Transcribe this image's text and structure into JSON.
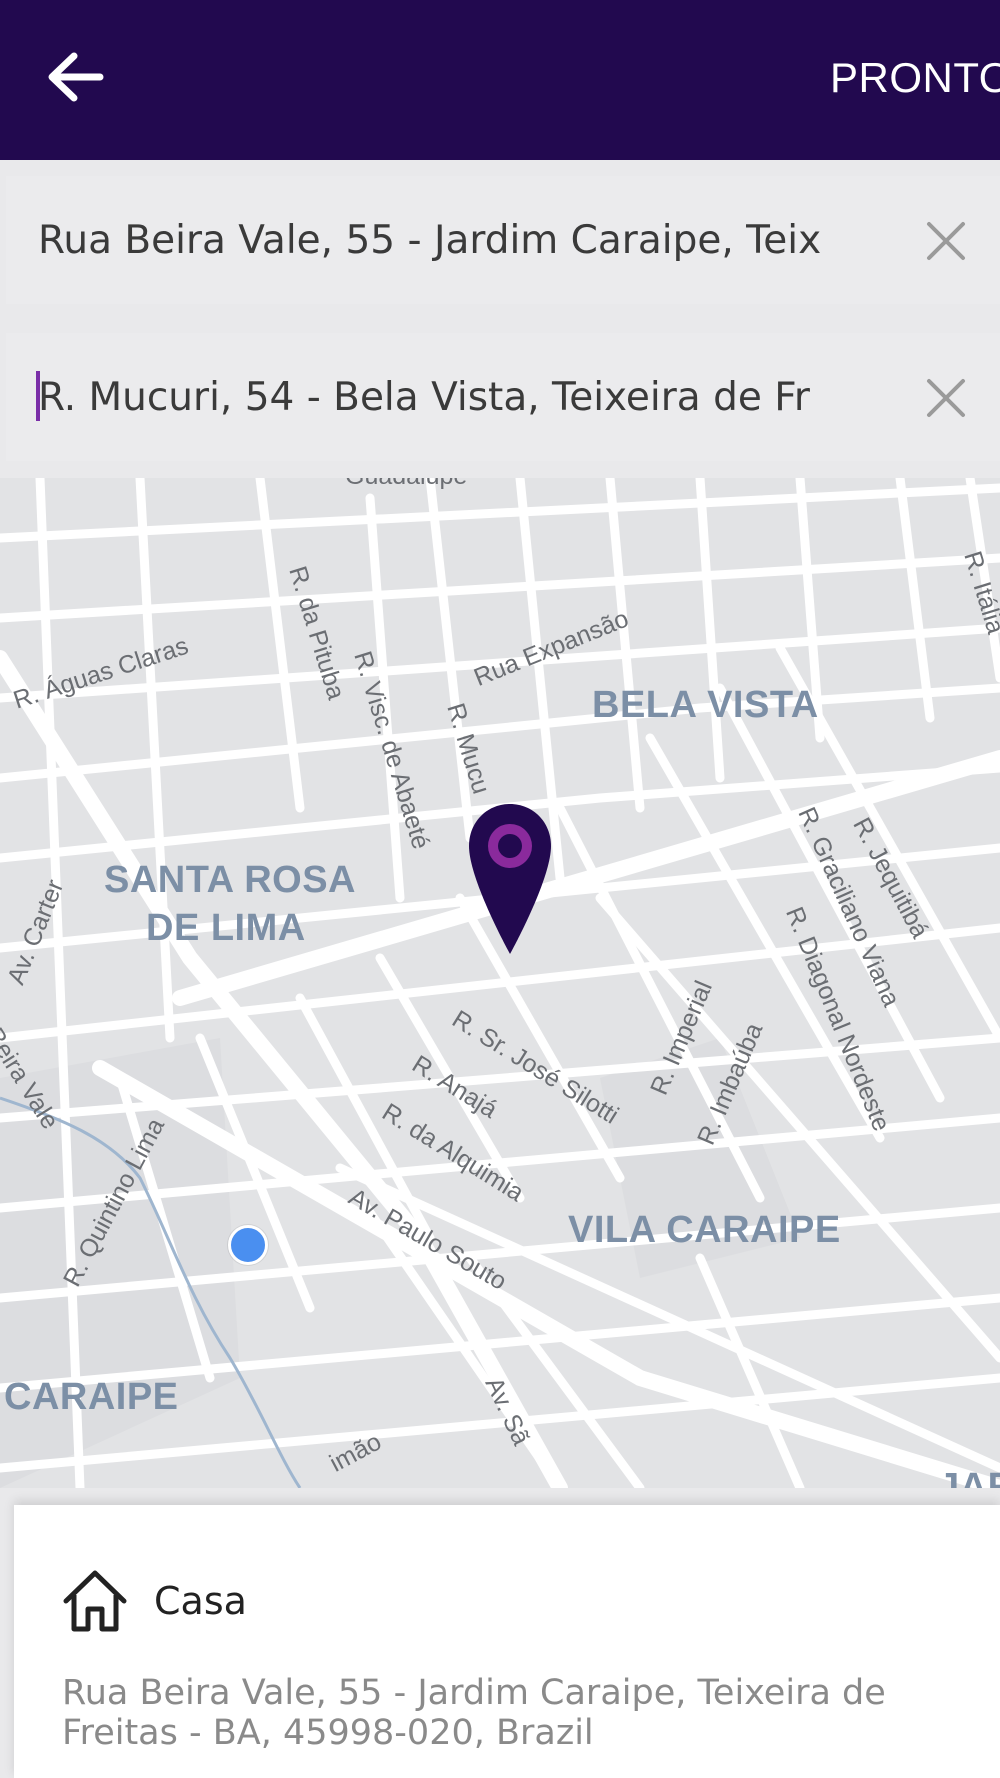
{
  "header": {
    "back_icon": "arrow-left-icon",
    "done_label": "PRONTO",
    "background": "#22094f"
  },
  "route": {
    "pickup": {
      "value": "Rua Beira Vale, 55 - Jardim Caraipe, Teix",
      "clear_icon": "close-icon"
    },
    "destination": {
      "value": "R. Mucuri, 54 - Bela Vista, Teixeira de Fr",
      "clear_icon": "close-icon"
    }
  },
  "map": {
    "neighborhoods": {
      "bela_vista": "BELA VISTA",
      "santa_rosa_1": "SANTA ROSA",
      "santa_rosa_2": "DE LIMA",
      "vila_caraipe": "VILA CARAIPE",
      "caraipe": "CARAIPE",
      "jar": "JAR"
    },
    "streets": {
      "aguas_claras": "R. Águas Claras",
      "pituba": "R. da Pituba",
      "visc_abaete": "R. Visc. de Abaeté",
      "mucuri": "R. Mucu",
      "expansao": "Rua Expansão",
      "italia": "R. Itália",
      "graciliano": "R. Graciliano Viana",
      "jequitiba": "R. Jequitibá",
      "diagonal": "R. Diagonal Nordeste",
      "carter": "Av. Carter",
      "beira_vale": "Beira Vale",
      "quintino": "R. Quintino Lima",
      "jose_silotti": "R. Sr. José Silotti",
      "imperial": "R. Imperial",
      "imbauba": "R. Imbaúba",
      "anaja": "R. Anajá",
      "alquimia": "R. da Alquimia",
      "paulo_souto": "Av. Paulo Souto",
      "sao": "Av. Sã",
      "simao": "imão",
      "top_cut": "Guadalupe"
    },
    "destination_pin_icon": "map-pin-icon",
    "current_location_icon": "current-location-dot-icon",
    "pin_color": "#22094f",
    "pin_accent": "#8a2a9c",
    "location_dot_color": "#4a8ff0"
  },
  "saved_place": {
    "icon": "home-icon",
    "name": "Casa",
    "address": "Rua Beira Vale, 55 - Jardim Caraipe, Teixeira de Freitas - BA, 45998-020, Brazil"
  }
}
